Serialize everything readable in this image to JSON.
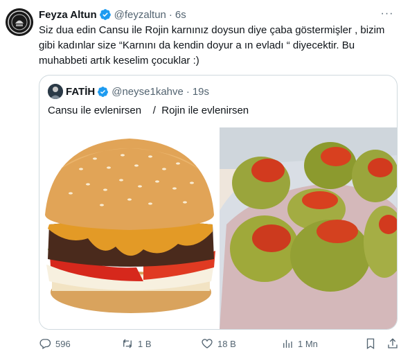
{
  "tweet": {
    "author_name": "Feyza Altun",
    "author_handle": "@feyzaltun",
    "separator": "·",
    "time": "6s",
    "text": "Siz dua edin Cansu ile Rojin karnınız doysun diye çaba göstermişler , bizim gibi kadınlar size “Karnını da kendin doyur a‌ ın evladı “ diyecektir. Bu muhabbeti artık keselim çocuklar :)",
    "avatar_icon": "circular-seal-avatar",
    "menu_icon": "more-icon"
  },
  "quote": {
    "author_name": "FATİH",
    "author_handle": "@neyse1kahve",
    "separator": "·",
    "time": "19s",
    "text": "Cansu ile evlenirsen    /  Rojin ile evlenirsen",
    "media": [
      "hamburger-photo",
      "stuffed-peppers-photo"
    ]
  },
  "actions": {
    "reply_count": "596",
    "retweet_count": "1 B",
    "like_count": "18 B",
    "views_count": "1 Mn"
  },
  "colors": {
    "text": "#0f1419",
    "secondary": "#536471",
    "verified": "#1d9bf0",
    "border": "#cfd9de"
  }
}
